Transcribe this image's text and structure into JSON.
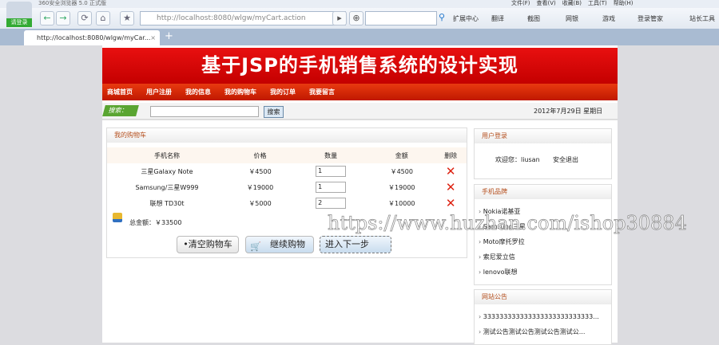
{
  "browser": {
    "app_title": "360安全浏览器 5.0 正式版",
    "login_label": "请登录",
    "url": "http://localhost:8080/wlgw/myCart.action",
    "tab_title": "http://localhost:8080/wlgw/myCar...",
    "menu": [
      "文件(F)",
      "查看(V)",
      "收藏(B)",
      "工具(T)",
      "帮助(H)"
    ],
    "extensions": [
      "扩展中心",
      "翻译",
      "截图",
      "网银",
      "游戏",
      "登录管家",
      "站长工具"
    ]
  },
  "site": {
    "title": "基于JSP的手机销售系统的设计实现",
    "nav": [
      "商城首页",
      "用户注册",
      "我的信息",
      "我的购物车",
      "我的订单",
      "我要留言"
    ],
    "search_label": "搜索：",
    "search_button": "搜索",
    "date": "2012年7月29日 星期日"
  },
  "cart": {
    "title": "我的购物车",
    "headers": [
      "手机名称",
      "价格",
      "数量",
      "金额",
      "删除"
    ],
    "rows": [
      {
        "name": "三星Galaxy Note",
        "price": "￥4500",
        "qty": "1",
        "amount": "￥4500"
      },
      {
        "name": "Samsung/三星W999",
        "price": "￥19000",
        "qty": "1",
        "amount": "￥19000"
      },
      {
        "name": "联想 TD30t",
        "price": "￥5000",
        "qty": "2",
        "amount": "￥10000"
      }
    ],
    "total": "总金额：￥33500",
    "clear": "•清空购物车",
    "continue": "继续购物",
    "next": "进入下一步"
  },
  "login": {
    "title": "用户登录",
    "welcome": "欢迎您：liusan",
    "logout": "安全退出"
  },
  "brands": {
    "title": "手机品牌",
    "items": [
      "Nokia诺基亚",
      "Samsung三星",
      "Moto摩托罗拉",
      "索尼爱立信",
      "lenovo联想"
    ]
  },
  "notice": {
    "title": "网站公告",
    "items": [
      "333333333333333333333333333...",
      "测试公告测试公告测试公告测试公..."
    ]
  },
  "watermark": "https://www.huzhan.com/ishop30884"
}
